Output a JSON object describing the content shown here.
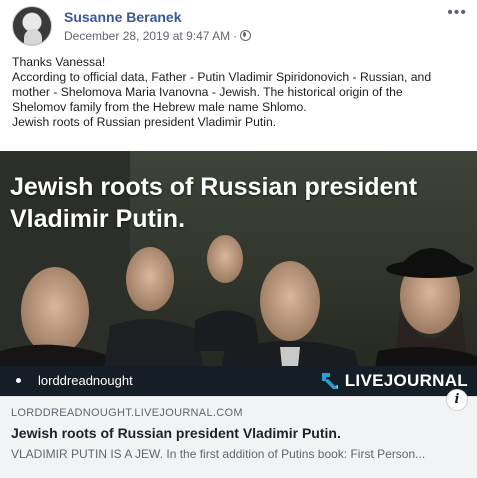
{
  "post": {
    "author": "Susanne Beranek",
    "timestamp": "December 28, 2019 at 9:47 AM",
    "separator": "·",
    "privacy_icon": "globe-icon",
    "more_label": "•••",
    "lines": [
      "Thanks Vanessa!",
      "According to official data, Father - Putin Vladimir Spiridonovich - Russian, and",
      "mother - Shelomova Maria Ivanovna - Jewish. The historical origin of the",
      "Shelomov family from the Hebrew male name Shlomo.",
      "Jewish roots of Russian president Vladimir Putin."
    ]
  },
  "link_preview": {
    "image_headline_line1": "Jewish roots of Russian president",
    "image_headline_line2": "Vladimir Putin.",
    "image_username": "lorddreadnought",
    "brand": "LIVEJOURNAL",
    "domain": "LORDDREADNOUGHT.LIVEJOURNAL.COM",
    "title": "Jewish roots of Russian president Vladimir Putin.",
    "description": "VLADIMIR PUTIN IS A JEW. In the first addition of Putins book: First Person...",
    "info_label": "i"
  },
  "colors": {
    "author": "#385898",
    "brand_bg": "#151d26",
    "brand_mark": "#2a9fd6",
    "card_bg": "#f2f3f5"
  }
}
